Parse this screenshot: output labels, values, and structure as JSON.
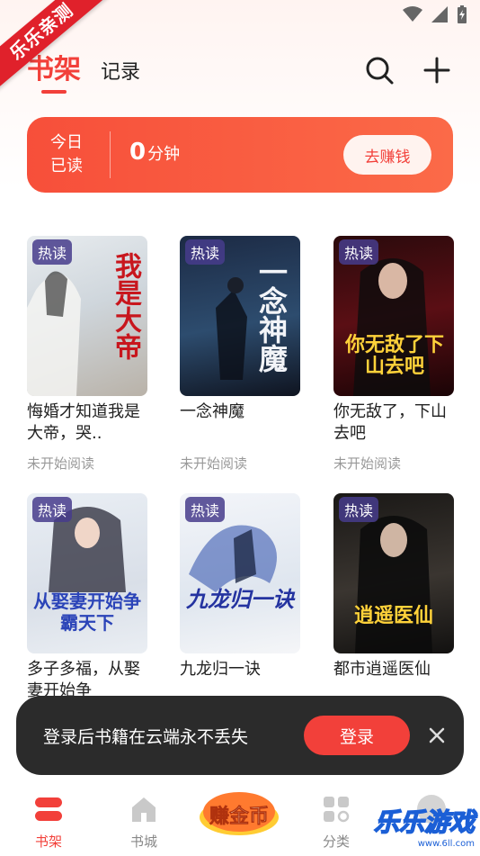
{
  "watermark_ribbon": "乐乐亲测",
  "header": {
    "tab_active": "书架",
    "tab_record": "记录"
  },
  "reading": {
    "today_label": "今日已读",
    "minutes_value": "0",
    "minutes_unit": "分钟",
    "earn_button": "去赚钱"
  },
  "books": [
    {
      "hot_tag": "热读",
      "title": "悔婚才知道我是大帝，哭..",
      "status": "未开始阅读",
      "cover_text": "我是大帝"
    },
    {
      "hot_tag": "热读",
      "title": "一念神魔",
      "status": "未开始阅读",
      "cover_text": "一念神魔"
    },
    {
      "hot_tag": "热读",
      "title": "你无敌了，下山去吧",
      "status": "未开始阅读",
      "cover_text": "你无敌了下山去吧"
    },
    {
      "hot_tag": "热读",
      "title": "多子多福，从娶妻开始争",
      "status": "",
      "cover_text": "从娶妻开始争霸天下"
    },
    {
      "hot_tag": "热读",
      "title": "九龙归一诀",
      "status": "",
      "cover_text": "九龙归一诀"
    },
    {
      "hot_tag": "热读",
      "title": "都市逍遥医仙",
      "status": "",
      "cover_text": "逍遥医仙"
    }
  ],
  "toast": {
    "text": "登录后书籍在云端永不丢失",
    "login_button": "登录"
  },
  "bottom_nav": {
    "shelf": "书架",
    "store": "书城",
    "gold": "赚金币",
    "category": "分类"
  },
  "site_watermark": {
    "text": "乐乐游戏",
    "sub": "www.6ll.com"
  },
  "colors": {
    "accent": "#f2403a",
    "banner_start": "#f74f3a",
    "banner_end": "#fb6a48",
    "toast_bg": "#2b2b2b"
  }
}
